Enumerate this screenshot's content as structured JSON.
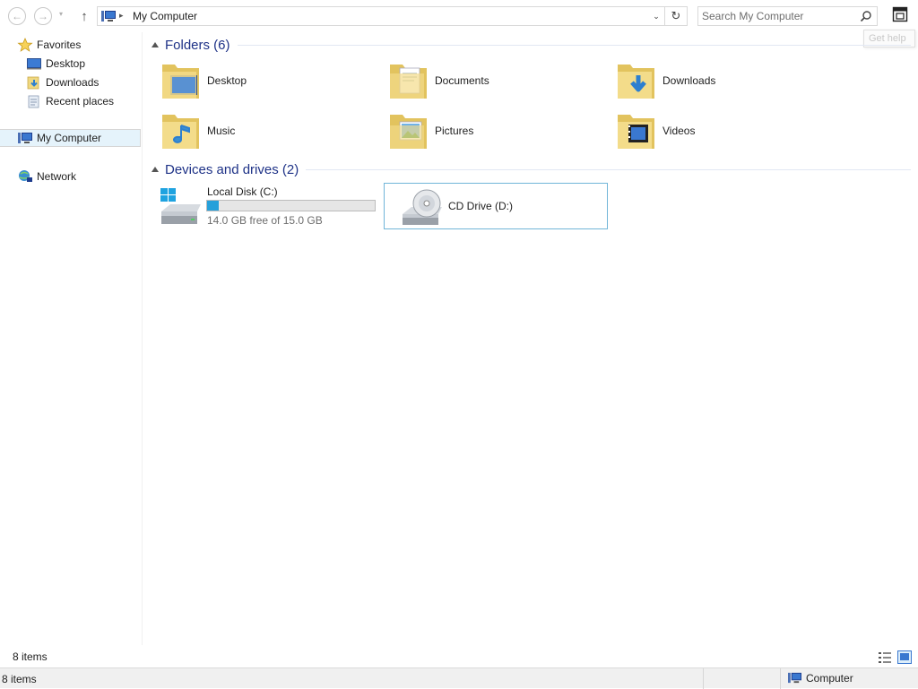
{
  "toolbar": {
    "back_glyph": "←",
    "forward_glyph": "→",
    "recent_glyph": "▾",
    "up_glyph": "↑",
    "address_separator": "▸",
    "address_text": "My Computer",
    "address_dropdown_glyph": "⌄",
    "refresh_glyph": "↻",
    "search_placeholder": "Search My Computer",
    "help_tooltip": "Get help"
  },
  "nav": {
    "favorites": "Favorites",
    "items": [
      "Desktop",
      "Downloads",
      "Recent places"
    ],
    "computer": "My Computer",
    "network": "Network"
  },
  "folders": {
    "title": "Folders (6)",
    "items": [
      "Desktop",
      "Documents",
      "Downloads",
      "Music",
      "Pictures",
      "Videos"
    ]
  },
  "drives": {
    "title": "Devices and drives (2)",
    "local": {
      "label": "Local Disk (C:)",
      "free": "14.0 GB free of 15.0 GB",
      "used_fraction": 0.067
    },
    "cd": {
      "label": "CD Drive (D:)"
    }
  },
  "status": {
    "count": "8 items",
    "bar_count": "8 items",
    "zone": "Computer"
  },
  "colors": {
    "accent": "#1e3287",
    "selection": "#e5f3fb",
    "drive_bar": "#26a0da",
    "folder": "#f0d880"
  }
}
